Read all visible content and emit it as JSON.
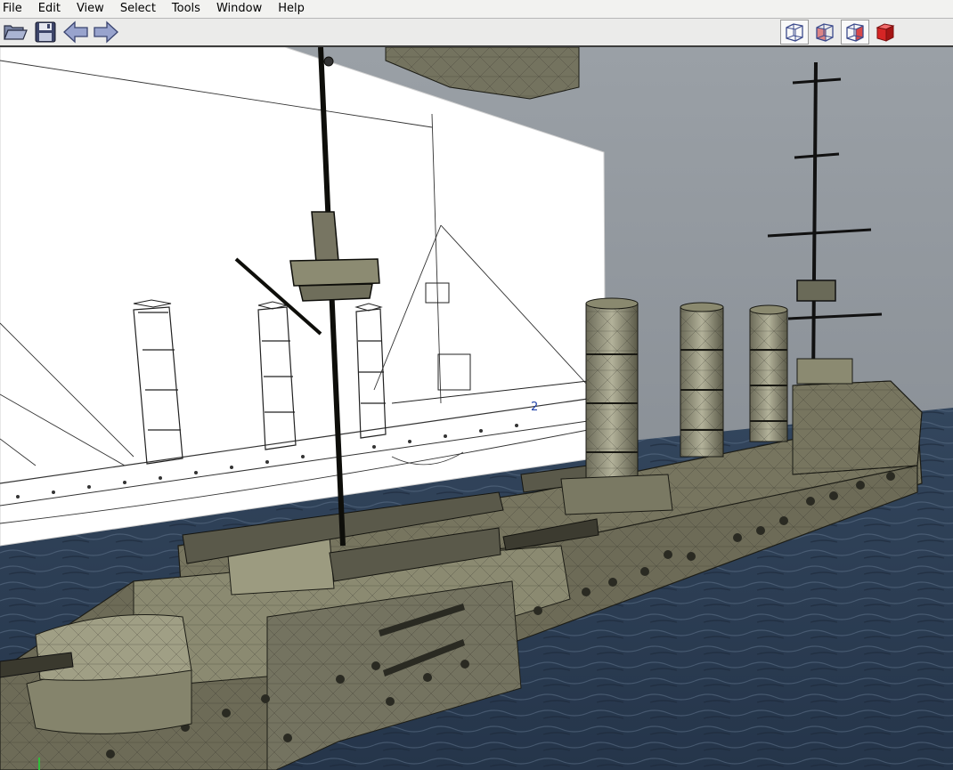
{
  "menu": {
    "file": "File",
    "edit": "Edit",
    "view": "View",
    "select": "Select",
    "tools": "Tools",
    "window": "Window",
    "help": "Help"
  },
  "toolbar": {
    "buttons": [
      "folder-open-icon",
      "save-disk-icon",
      "back-arrow-icon",
      "forward-arrow-icon"
    ],
    "view_modes": [
      "wireframe-cube-icon",
      "wireframe-cube-red-face-icon",
      "wireframe-cube-red-side-icon",
      "solid-red-cube-icon"
    ]
  },
  "colors": {
    "menu_bg": "#f2f2f0",
    "toolbar_bg": "#ebebea",
    "viewport_bg": "#8f9499",
    "water": "#2c3d52",
    "hull": "#6e6b59",
    "blueprint_bg": "#ffffff",
    "accent_red": "#d62525",
    "icon_blue": "#6e7fb5"
  },
  "viewport": {
    "blueprint_label": "2"
  }
}
